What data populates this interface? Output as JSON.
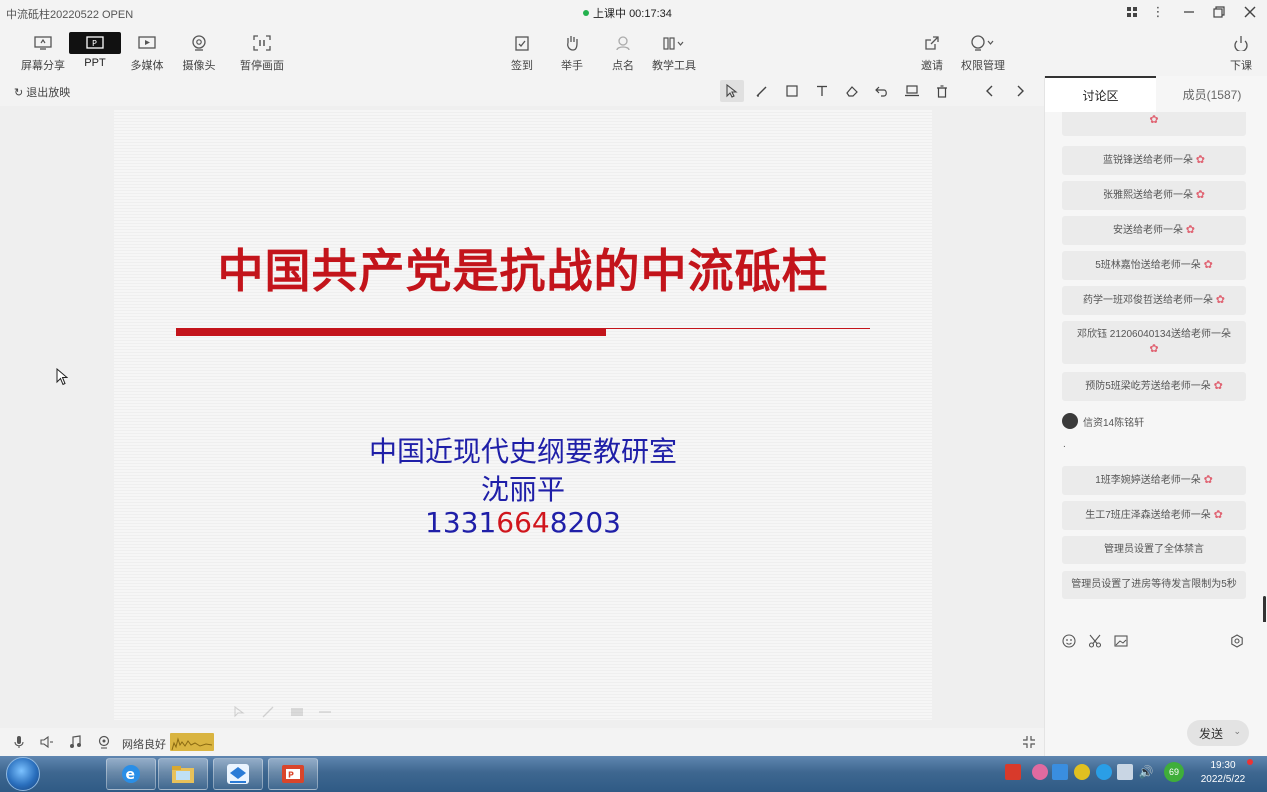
{
  "window": {
    "title": "中流砥柱20220522 OPEN",
    "status_label": "上课中",
    "timer": "00:17:34"
  },
  "toolbar": {
    "screen_share": "屏幕分享",
    "ppt": "PPT",
    "multimedia": "多媒体",
    "camera": "摄像头",
    "pause_screen": "暂停画面",
    "sign_in": "签到",
    "raise_hand": "举手",
    "roll_call": "点名",
    "teaching_tools": "教学工具",
    "invite": "邀请",
    "permissions": "权限管理",
    "end_class": "下课"
  },
  "subbar": {
    "exit_show": "退出放映"
  },
  "slide": {
    "title": "中国共产党是抗战的中流砥柱",
    "department": "中国近现代史纲要教研室",
    "name": "沈丽平",
    "phone_part1": "1331",
    "phone_part2": "664",
    "phone_part3": "8203"
  },
  "bottom": {
    "network": "网络良好"
  },
  "panel": {
    "tab_discussion": "讨论区",
    "tab_members": "成员(1587)",
    "messages": [
      "蓝锐锋送给老师一朵",
      "张雅熙送给老师一朵",
      "安送给老师一朵",
      "5班林嘉怡送给老师一朵",
      "药学一班邓俊哲送给老师一朵",
      "邓欣钰 21206040134送给老师一朵",
      "预防5班梁屹芳送给老师一朵",
      "1班李婉婷送给老师一朵",
      "生工7班庄泽森送给老师一朵",
      "管理员设置了全体禁言",
      "管理员设置了进房等待发言限制为5秒"
    ],
    "user_name": "信资14陈铭轩",
    "user_message": ".",
    "send_label": "发送"
  },
  "taskbar": {
    "time": "19:30",
    "date": "2022/5/22",
    "tray_badge": "69"
  },
  "colors": {
    "slide_red": "#c3141b",
    "slide_blue": "#1f1fa8",
    "live_green": "#23b14d"
  }
}
